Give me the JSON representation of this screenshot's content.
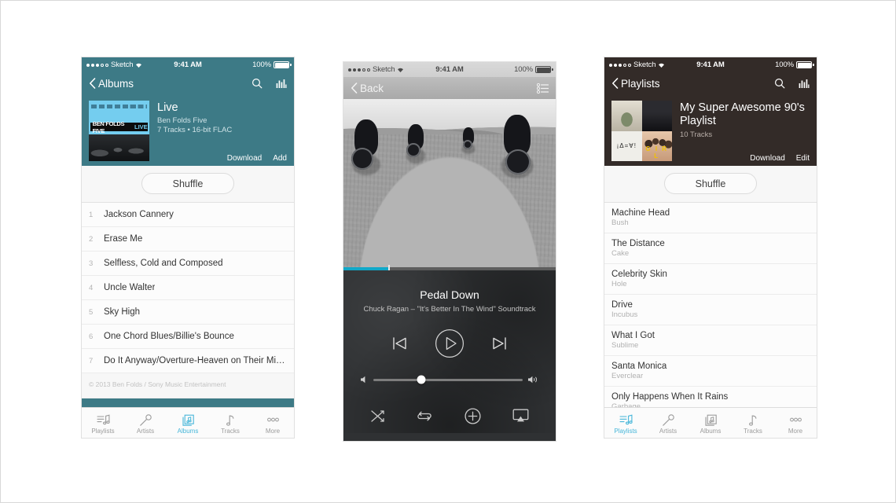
{
  "meta": {
    "accent_teal": "#11a8c8",
    "header_teal": "#3d7a86",
    "header_dark": "#332b28"
  },
  "status_bar": {
    "carrier": "Sketch",
    "time": "9:41 AM",
    "battery": "100%",
    "signal_filled": 3,
    "signal_empty": 2
  },
  "phone1": {
    "nav": {
      "back_label": "Albums",
      "search_icon": "search-icon",
      "eq_icon": "equalizer-icon"
    },
    "hero": {
      "title": "Live",
      "artist": "Ben Folds Five",
      "meta": "7 Tracks • 16-bit FLAC",
      "artwork": {
        "band_primary": "BEN FOLDS FIVE",
        "band_accent": "LIVE"
      },
      "download_label": "Download",
      "add_label": "Add"
    },
    "shuffle_label": "Shuffle",
    "tracks": [
      {
        "num": "1",
        "name": "Jackson Cannery"
      },
      {
        "num": "2",
        "name": "Erase Me"
      },
      {
        "num": "3",
        "name": "Selfless, Cold and Composed"
      },
      {
        "num": "4",
        "name": "Uncle Walter"
      },
      {
        "num": "5",
        "name": "Sky High"
      },
      {
        "num": "6",
        "name": "One Chord Blues/Billie's Bounce"
      },
      {
        "num": "7",
        "name": "Do It Anyway/Overture-Heaven on Their Mi…"
      }
    ],
    "copyright": "© 2013 Ben Folds / Sony Music Entertainment",
    "tabs": [
      {
        "label": "Playlists",
        "icon": "playlists-icon",
        "active": false
      },
      {
        "label": "Artists",
        "icon": "microphone-icon",
        "active": false
      },
      {
        "label": "Albums",
        "icon": "albums-icon",
        "active": true
      },
      {
        "label": "Tracks",
        "icon": "note-icon",
        "active": false
      },
      {
        "label": "More",
        "icon": "more-icon",
        "active": false
      }
    ]
  },
  "phone2": {
    "nav": {
      "back_label": "Back",
      "queue_icon": "queue-list-icon"
    },
    "artwork_alt": "four motorcyclists riding on a desert road, black and white",
    "progress_percent": 21,
    "now_playing": {
      "title": "Pedal Down",
      "subtitle": "Chuck Ragan – \"It's Better In The Wind\" Soundtrack"
    },
    "controls": [
      {
        "icon": "previous-track-icon",
        "name": "previous-button"
      },
      {
        "icon": "play-icon",
        "name": "play-button"
      },
      {
        "icon": "next-track-icon",
        "name": "next-button"
      }
    ],
    "volume": {
      "percent": 32,
      "min_icon": "volume-low-icon",
      "max_icon": "volume-high-icon"
    },
    "bottom_controls": [
      {
        "icon": "shuffle-icon",
        "name": "shuffle-button"
      },
      {
        "icon": "repeat-icon",
        "name": "repeat-button"
      },
      {
        "icon": "add-icon",
        "name": "add-button"
      },
      {
        "icon": "airplay-icon",
        "name": "airplay-button"
      }
    ]
  },
  "phone3": {
    "nav": {
      "back_label": "Playlists",
      "search_icon": "search-icon",
      "eq_icon": "equalizer-icon"
    },
    "hero": {
      "title": "My Super Awesome 90's Playlist",
      "meta": "10 Tracks",
      "download_label": "Download",
      "edit_label": "Edit",
      "artwork_grid": [
        "album-art-1",
        "album-art-2",
        "album-art-3",
        "album-art-4"
      ],
      "artwork_3_text": "¡Δ=∀!",
      "artwork_4_text": "G I R L"
    },
    "shuffle_label": "Shuffle",
    "tracks": [
      {
        "name": "Machine Head",
        "artist": "Bush"
      },
      {
        "name": "The Distance",
        "artist": "Cake"
      },
      {
        "name": "Celebrity Skin",
        "artist": "Hole"
      },
      {
        "name": "Drive",
        "artist": "Incubus"
      },
      {
        "name": "What I Got",
        "artist": "Sublime"
      },
      {
        "name": "Santa Monica",
        "artist": "Everclear"
      },
      {
        "name": "Only Happens When It Rains",
        "artist": "Garbage"
      }
    ],
    "tabs": [
      {
        "label": "Playlists",
        "icon": "playlists-icon",
        "active": true
      },
      {
        "label": "Artists",
        "icon": "microphone-icon",
        "active": false
      },
      {
        "label": "Albums",
        "icon": "albums-icon",
        "active": false
      },
      {
        "label": "Tracks",
        "icon": "note-icon",
        "active": false
      },
      {
        "label": "More",
        "icon": "more-icon",
        "active": false
      }
    ]
  }
}
